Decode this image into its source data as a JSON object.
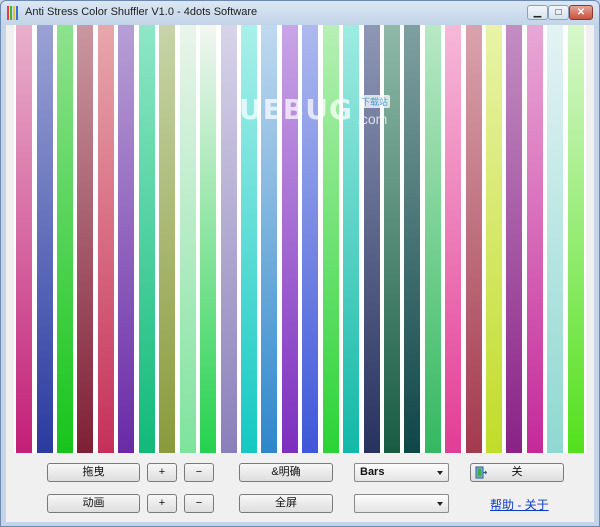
{
  "window": {
    "title": "Anti Stress Color Shuffler V1.0 - 4dots Software"
  },
  "watermark": {
    "text": "UEBUG",
    "sub": ".com",
    "badge": "下载站"
  },
  "bars": [
    {
      "top": "#e8b0cc",
      "bottom": "#c31f77"
    },
    {
      "top": "#9aa2d4",
      "bottom": "#2b3aa0"
    },
    {
      "top": "#8ee28e",
      "bottom": "#17c41b"
    },
    {
      "top": "#ca97a0",
      "bottom": "#7f1f36"
    },
    {
      "top": "#e8a7ab",
      "bottom": "#c5305a"
    },
    {
      "top": "#b79fd6",
      "bottom": "#6a2aa6"
    },
    {
      "top": "#8ee7c6",
      "bottom": "#11b97a"
    },
    {
      "top": "#c7d4a8",
      "bottom": "#899a3c"
    },
    {
      "top": "#eaf4ec",
      "bottom": "#7ee39d"
    },
    {
      "top": "#f2f6f2",
      "bottom": "#25d24e"
    },
    {
      "top": "#d8d4e8",
      "bottom": "#8a7fb9"
    },
    {
      "top": "#a9f0ea",
      "bottom": "#14c9c1"
    },
    {
      "top": "#c0d9ef",
      "bottom": "#2e87cc"
    },
    {
      "top": "#c9a5e6",
      "bottom": "#7c2fbf"
    },
    {
      "top": "#aeb9ef",
      "bottom": "#3f57d9"
    },
    {
      "top": "#b6f0b4",
      "bottom": "#2ad336"
    },
    {
      "top": "#9febe2",
      "bottom": "#12b8a8"
    },
    {
      "top": "#8e97b5",
      "bottom": "#27325f"
    },
    {
      "top": "#8fb9a9",
      "bottom": "#195c44"
    },
    {
      "top": "#7fa0a0",
      "bottom": "#0f4648"
    },
    {
      "top": "#b8e8c5",
      "bottom": "#35b861"
    },
    {
      "top": "#f6b8d8",
      "bottom": "#e23d95"
    },
    {
      "top": "#d9a3ad",
      "bottom": "#a33a4e"
    },
    {
      "top": "#e9f3a8",
      "bottom": "#c1dc29"
    },
    {
      "top": "#c28ec2",
      "bottom": "#8a2287"
    },
    {
      "top": "#e8a8d6",
      "bottom": "#c4299a"
    },
    {
      "top": "#e4f3f4",
      "bottom": "#8fd8d1"
    },
    {
      "top": "#d8f7cc",
      "bottom": "#53e01c"
    }
  ],
  "controls": {
    "drag_label": "拖曳",
    "animate_label": "动画",
    "plus_label": "+",
    "minus_label": "−",
    "hide_label": "&明确",
    "fullscreen_label": "全屏",
    "mode_value": "Bars",
    "second_combo_value": "",
    "close_label": "关",
    "help_link": "帮助 - 关于"
  }
}
